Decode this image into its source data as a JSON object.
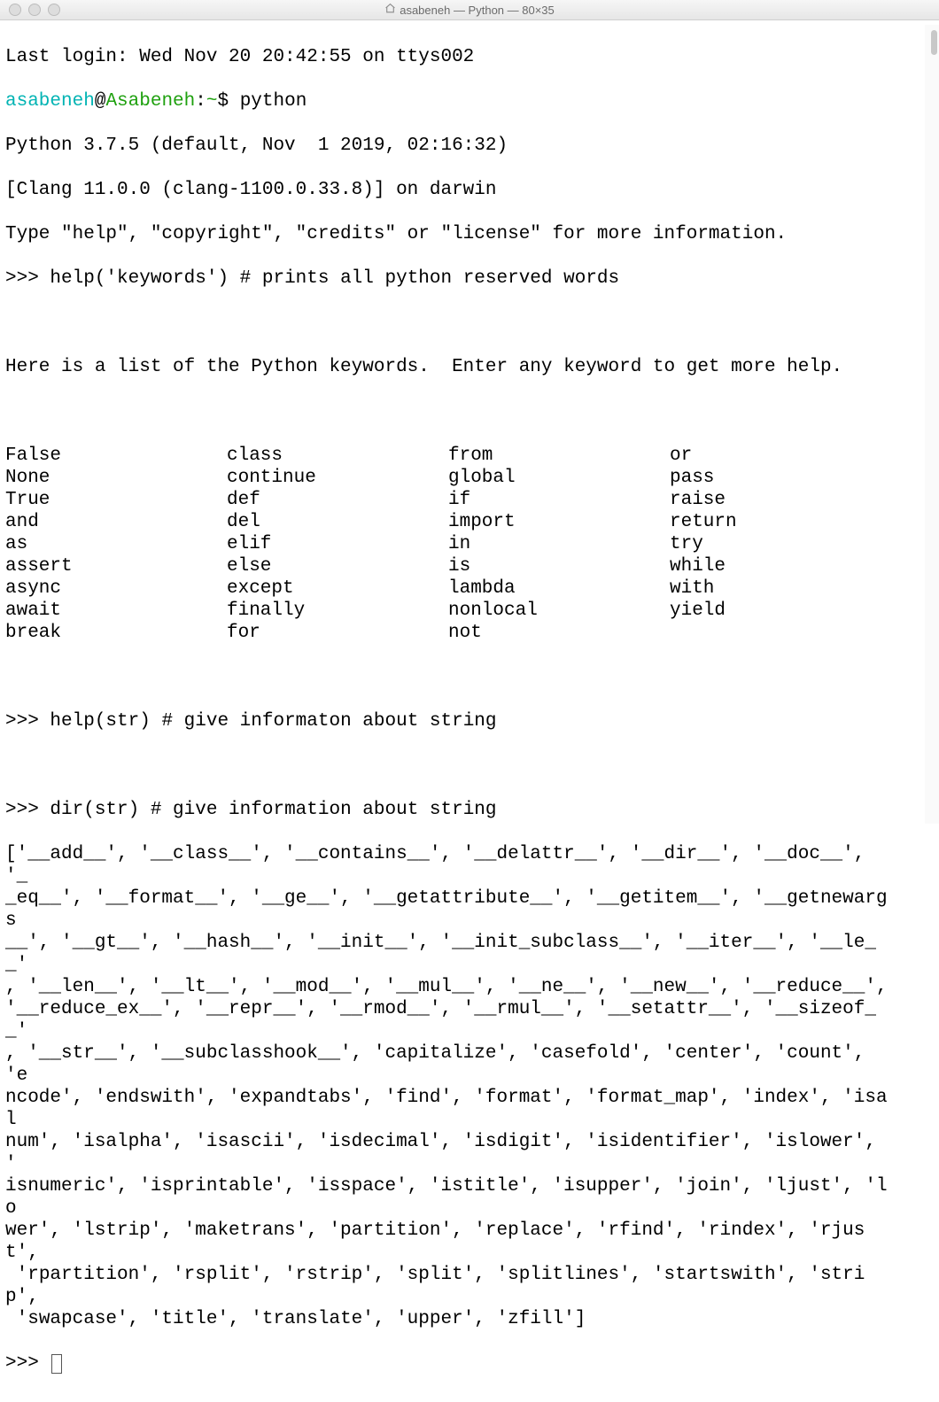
{
  "window": {
    "title": "asabeneh — Python — 80×35"
  },
  "session": {
    "last_login": "Last login: Wed Nov 20 20:42:55 on ttys002",
    "prompt_user": "asabeneh",
    "prompt_at": "@",
    "prompt_host": "Asabeneh",
    "prompt_sep": ":",
    "prompt_path": "~",
    "prompt_end": "$ ",
    "cmd_python": "python",
    "py_version": "Python 3.7.5 (default, Nov  1 2019, 02:16:32) ",
    "clang": "[Clang 11.0.0 (clang-1100.0.33.8)] on darwin",
    "hint": "Type \"help\", \"copyright\", \"credits\" or \"license\" for more information.",
    "repl_prompt": ">>> ",
    "line_keywords": "help('keywords') # prints all python reserved words",
    "kw_intro": "Here is a list of the Python keywords.  Enter any keyword to get more help.",
    "keywords": [
      [
        "False",
        "class",
        "from",
        "or"
      ],
      [
        "None",
        "continue",
        "global",
        "pass"
      ],
      [
        "True",
        "def",
        "if",
        "raise"
      ],
      [
        "and",
        "del",
        "import",
        "return"
      ],
      [
        "as",
        "elif",
        "in",
        "try"
      ],
      [
        "assert",
        "else",
        "is",
        "while"
      ],
      [
        "async",
        "except",
        "lambda",
        "with"
      ],
      [
        "await",
        "finally",
        "nonlocal",
        "yield"
      ],
      [
        "break",
        "for",
        "not",
        ""
      ]
    ],
    "line_helpstr": "help(str) # give informaton about string",
    "line_dirstr": "dir(str) # give information about string",
    "dir_output": "['__add__', '__class__', '__contains__', '__delattr__', '__dir__', '__doc__', '__eq__', '__format__', '__ge__', '__getattribute__', '__getitem__', '__getnewargs__', '__gt__', '__hash__', '__init__', '__init_subclass__', '__iter__', '__le__', '__len__', '__lt__', '__mod__', '__mul__', '__ne__', '__new__', '__reduce__', '__reduce_ex__', '__repr__', '__rmod__', '__rmul__', '__setattr__', '__sizeof__', '__str__', '__subclasshook__', 'capitalize', 'casefold', 'center', 'count', 'encode', 'endswith', 'expandtabs', 'find', 'format', 'format_map', 'index', 'isalnum', 'isalpha', 'isascii', 'isdecimal', 'isdigit', 'isidentifier', 'islower', 'isnumeric', 'isprintable', 'isspace', 'istitle', 'isupper', 'join', 'ljust', 'lower', 'lstrip', 'maketrans', 'partition', 'replace', 'rfind', 'rindex', 'rjust', 'rpartition', 'rsplit', 'rstrip', 'split', 'splitlines', 'startswith', 'strip', 'swapcase', 'title', 'translate', 'upper', 'zfill']"
  }
}
